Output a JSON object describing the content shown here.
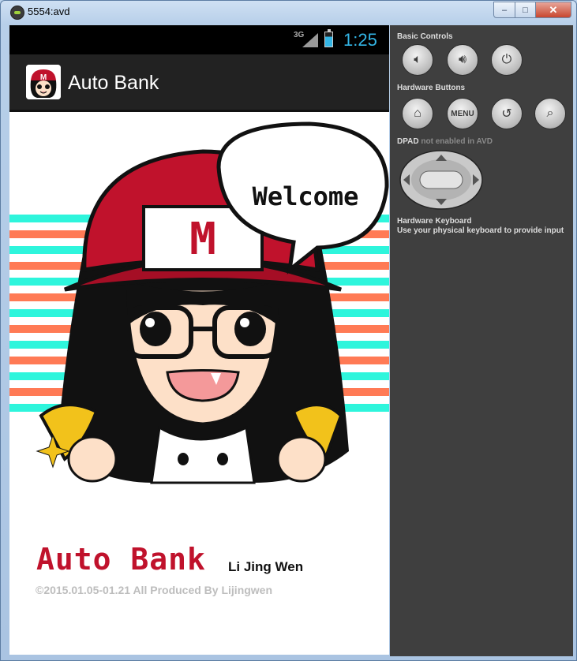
{
  "window": {
    "title": "5554:avd",
    "minimize_icon": "minimize-icon",
    "maximize_icon": "maximize-icon",
    "close_icon": "close-icon"
  },
  "status_bar": {
    "network": "3G",
    "time": "1:25",
    "icons": [
      "signal-icon",
      "battery-charging-icon"
    ]
  },
  "action_bar": {
    "title": "Auto Bank",
    "icon": "app-avatar-icon"
  },
  "splash": {
    "speech_bubble": "Welcome",
    "cap_letter": "M",
    "brand": "Auto Bank",
    "author": "Li Jing Wen",
    "credit": "©2015.01.05-01.21 All Produced By Lijingwen",
    "colors": {
      "brand": "#c0122c",
      "stripe_teal": "#2ef5dc",
      "stripe_orange": "#ff7a55"
    }
  },
  "controls": {
    "basic_controls_label": "Basic Controls",
    "basic_buttons": [
      "volume-down-icon",
      "volume-up-icon",
      "power-icon"
    ],
    "hardware_buttons_label": "Hardware Buttons",
    "hardware_buttons": [
      "home-icon",
      "menu-button",
      "back-icon",
      "search-icon"
    ],
    "menu_label": "MENU",
    "dpad_label": "DPAD",
    "dpad_note": "not enabled in AVD",
    "keyboard_label": "Hardware Keyboard",
    "keyboard_note": "Use your physical keyboard to provide input"
  }
}
